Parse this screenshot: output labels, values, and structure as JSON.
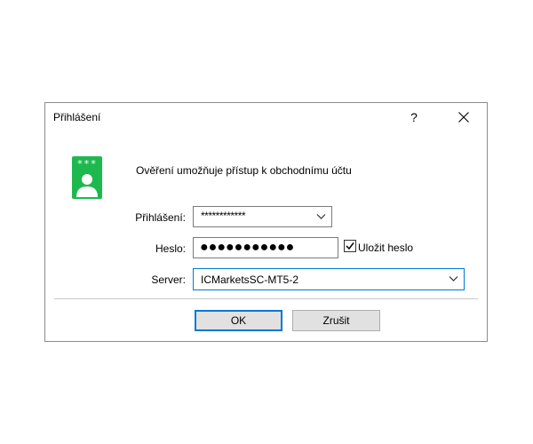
{
  "dialog": {
    "title": "Přihlášení",
    "help_label": "?",
    "headline": "Ověření umožňuje přístup k obchodnímu účtu",
    "icon_stars": "***"
  },
  "form": {
    "login_label": "Přihlášení:",
    "login_value": "************",
    "password_label": "Heslo:",
    "password_value": "●●●●●●●●●●●",
    "save_password_label": "Uložit heslo",
    "save_password_checked": true,
    "server_label": "Server:",
    "server_value": "ICMarketsSC-MT5-2"
  },
  "buttons": {
    "ok_label": "OK",
    "cancel_label": "Zrušit"
  },
  "colors": {
    "accent": "#0078d7",
    "icon_green": "#1db94e"
  }
}
